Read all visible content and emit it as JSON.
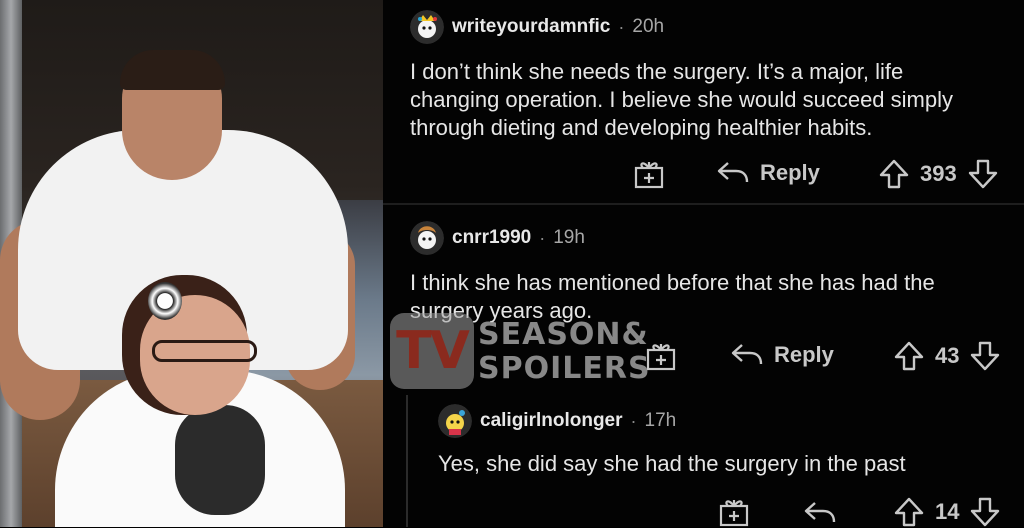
{
  "comments": [
    {
      "username": "writeyourdamnfic",
      "separator": "·",
      "time": "20h",
      "lines": [
        "I don’t think she needs the surgery. It’s a major, life",
        "changing operation. I believe she would succeed simply",
        "through dieting and developing healthier habits."
      ],
      "reply_label": "Reply",
      "score": "393"
    },
    {
      "username": "cnrr1990",
      "separator": "·",
      "time": "19h",
      "lines": [
        "I think she has mentioned before that she has had the",
        "surgery years ago."
      ],
      "reply_label": "Reply",
      "score": "43"
    },
    {
      "username": "caligirlnolonger",
      "separator": "·",
      "time": "17h",
      "lines": [
        "Yes, she did say she had the surgery in the past"
      ],
      "score": "14"
    }
  ],
  "watermark": {
    "badge": "TV",
    "line1": "SEASON&",
    "line2": "SPOILERS"
  },
  "colors": {
    "background": "#030303",
    "text": "#e6e6e6",
    "muted": "#a7a7a7",
    "watermark_red": "#8a2a1e"
  },
  "icons": [
    "more-icon",
    "award-icon",
    "reply-icon",
    "upvote-icon",
    "downvote-icon"
  ]
}
